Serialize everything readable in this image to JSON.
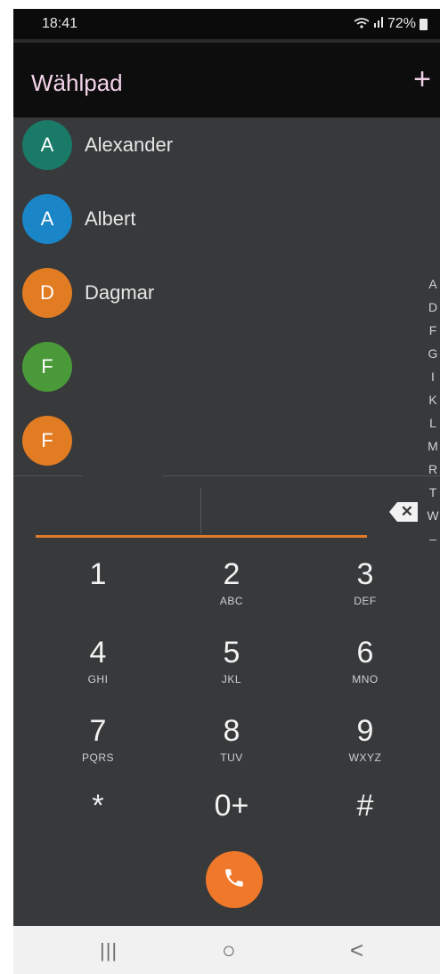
{
  "status": {
    "time": "18:41",
    "battery": "72%"
  },
  "appbar": {
    "title": "Wählpad",
    "add_label": "+"
  },
  "contacts": [
    {
      "initial": "A",
      "name": "Alexander",
      "color": "#1a7a68"
    },
    {
      "initial": "A",
      "name": "Albert",
      "color": "#1a86c8"
    },
    {
      "initial": "D",
      "name": "Dagmar",
      "color": "#e27c23"
    },
    {
      "initial": "F",
      "name": "",
      "color": "#4a9a3a"
    },
    {
      "initial": "F",
      "name": "",
      "color": "#e27c23"
    }
  ],
  "alphabet_index": [
    "A",
    "D",
    "F",
    "G",
    "I",
    "K",
    "L",
    "M",
    "R",
    "T",
    "W",
    "–"
  ],
  "keypad": [
    {
      "digit": "1",
      "letters": ""
    },
    {
      "digit": "2",
      "letters": "ABC"
    },
    {
      "digit": "3",
      "letters": "DEF"
    },
    {
      "digit": "4",
      "letters": "GHI"
    },
    {
      "digit": "5",
      "letters": "JKL"
    },
    {
      "digit": "6",
      "letters": "MNO"
    },
    {
      "digit": "7",
      "letters": "PQRS"
    },
    {
      "digit": "8",
      "letters": "TUV"
    },
    {
      "digit": "9",
      "letters": "WXYZ"
    },
    {
      "digit": "*",
      "letters": ""
    },
    {
      "digit": "0+",
      "letters": ""
    },
    {
      "digit": "#",
      "letters": ""
    }
  ],
  "colors": {
    "accent": "#f0782a",
    "background": "#37393b",
    "title": "#f3d3e8"
  },
  "icons": {
    "delete": "backspace-icon",
    "call": "phone-icon",
    "add": "plus-icon",
    "wifi": "wifi-icon",
    "signal": "signal-icon",
    "battery": "battery-icon"
  },
  "navbar": {
    "recents": "|||",
    "home": "○",
    "back": "<"
  }
}
